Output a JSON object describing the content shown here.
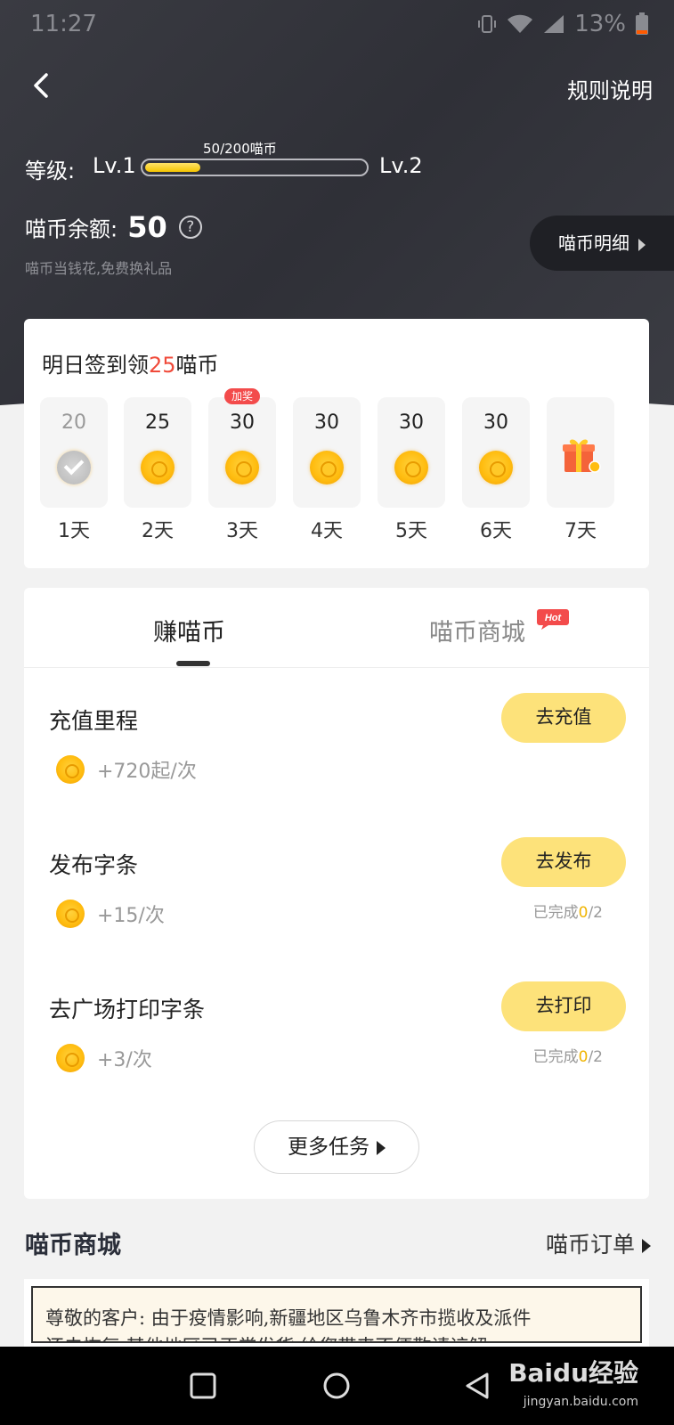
{
  "status_bar": {
    "time": "11:27",
    "battery": "13%"
  },
  "header": {
    "rules_label": "规则说明",
    "level_label": "等级:",
    "level_current": "Lv.1",
    "level_next": "Lv.2",
    "level_progress_text": "50/200喵币",
    "level_progress_fraction": 0.25,
    "balance_label": "喵币余额:",
    "balance_value": "50",
    "help_glyph": "?",
    "balance_sub": "喵币当钱花,免费换礼品",
    "detail_button": "喵币明细"
  },
  "signin": {
    "title_prefix": "明日签到领",
    "title_highlight": "25",
    "title_suffix": "喵币",
    "days": [
      {
        "value": "20",
        "label": "1天",
        "checked": true
      },
      {
        "value": "25",
        "label": "2天"
      },
      {
        "value": "30",
        "label": "3天",
        "tag": "加奖"
      },
      {
        "value": "30",
        "label": "4天"
      },
      {
        "value": "30",
        "label": "5天"
      },
      {
        "value": "30",
        "label": "6天"
      },
      {
        "value": "",
        "label": "7天",
        "icon": "gift-icon"
      }
    ]
  },
  "tabs": {
    "earn": "赚喵币",
    "mall": "喵币商城",
    "hot_badge": "Hot"
  },
  "tasks": [
    {
      "title": "充值里程",
      "reward": "+720起/次",
      "button": "去充值"
    },
    {
      "title": "发布字条",
      "reward": "+15/次",
      "button": "去发布",
      "progress_prefix": "已完成",
      "progress_done": "0",
      "progress_total": "/2"
    },
    {
      "title": "去广场打印字条",
      "reward": "+3/次",
      "button": "去打印",
      "progress_prefix": "已完成",
      "progress_done": "0",
      "progress_total": "/2"
    }
  ],
  "more_tasks": "更多任务",
  "mall": {
    "title": "喵币商城",
    "orders_link": "喵币订单"
  },
  "notice": {
    "line1": "尊敬的客户: 由于疫情影响,新疆地区乌鲁木齐市揽收及派件",
    "line2": "还未恢复,其他地区已正常发货,给您带来不便敬请谅解"
  },
  "watermark": {
    "brand": "Baidu经验",
    "url": "jingyan.baidu.com"
  },
  "colors": {
    "accent_yellow": "#fde27a",
    "highlight_red": "#f04a3a",
    "header_bg": "#33343b"
  }
}
